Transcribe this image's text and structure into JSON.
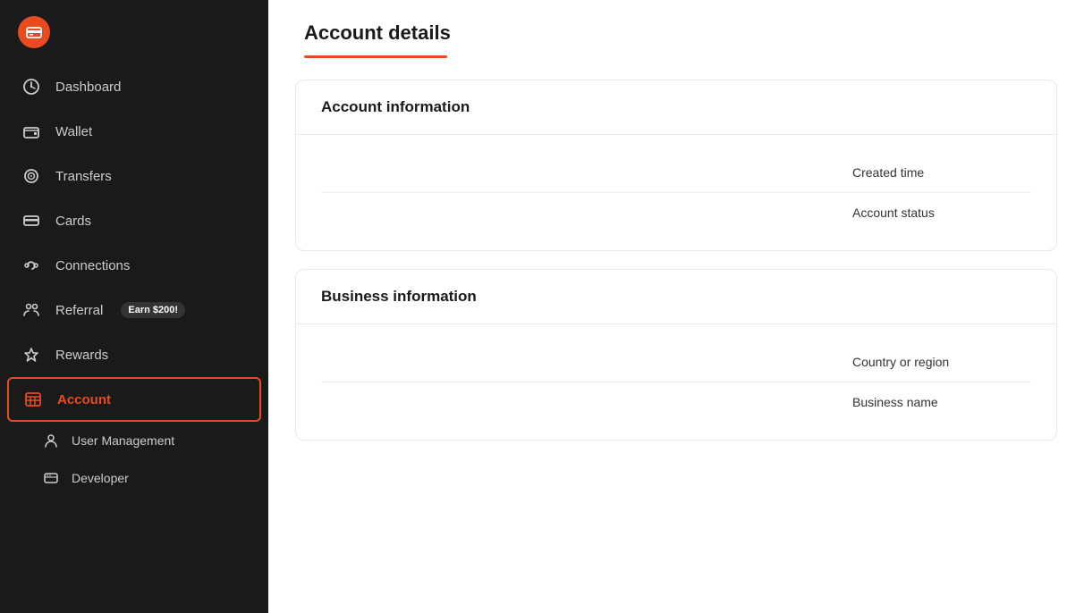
{
  "sidebar": {
    "logo_icon": "💳",
    "nav_items": [
      {
        "id": "dashboard",
        "label": "Dashboard",
        "icon": "dashboard"
      },
      {
        "id": "wallet",
        "label": "Wallet",
        "icon": "wallet"
      },
      {
        "id": "transfers",
        "label": "Transfers",
        "icon": "transfers"
      },
      {
        "id": "cards",
        "label": "Cards",
        "icon": "cards"
      },
      {
        "id": "connections",
        "label": "Connections",
        "icon": "connections"
      },
      {
        "id": "referral",
        "label": "Referral",
        "icon": "referral",
        "badge": "Earn $200!"
      },
      {
        "id": "rewards",
        "label": "Rewards",
        "icon": "rewards"
      },
      {
        "id": "account",
        "label": "Account",
        "icon": "account",
        "active": true
      }
    ],
    "sub_items": [
      {
        "id": "user-management",
        "label": "User Management",
        "icon": "user"
      },
      {
        "id": "developer",
        "label": "Developer",
        "icon": "developer"
      }
    ]
  },
  "main": {
    "page_title": "Account details",
    "sections": [
      {
        "id": "account-information",
        "title": "Account information",
        "fields": [
          {
            "label": "Created time",
            "value": ""
          },
          {
            "label": "Account status",
            "value": ""
          }
        ]
      },
      {
        "id": "business-information",
        "title": "Business information",
        "fields": [
          {
            "label": "Country or region",
            "value": ""
          },
          {
            "label": "Business name",
            "value": ""
          }
        ]
      }
    ]
  }
}
